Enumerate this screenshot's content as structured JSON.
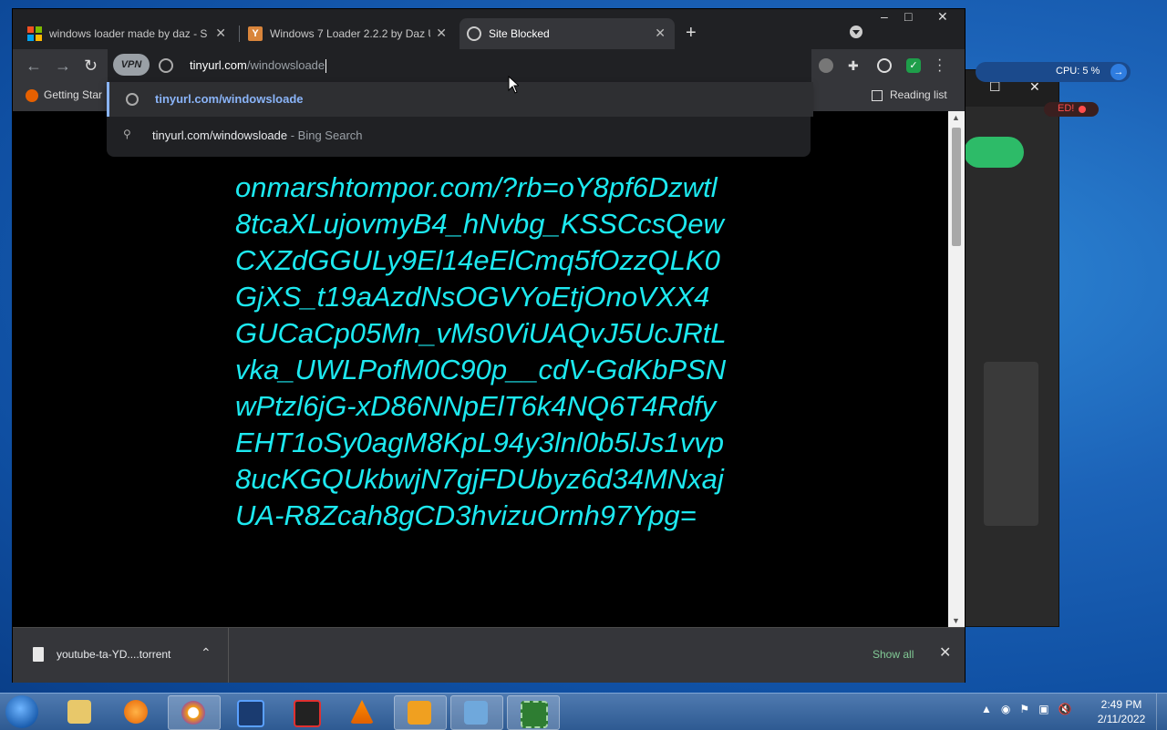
{
  "browser": {
    "tabs": [
      {
        "label": "windows loader made by daz - S",
        "icon": "microsoft-logo-icon",
        "active": false
      },
      {
        "label": "Windows 7 Loader 2.2.2 by Daz U",
        "icon": "y-favicon-icon",
        "active": false
      },
      {
        "label": "Site Blocked",
        "icon": "globe-icon",
        "active": true
      }
    ],
    "window_controls": {
      "minimize": "–",
      "maximize": "□",
      "close": "✕"
    },
    "omnibox": {
      "vpn_label": "VPN",
      "url_host": "tinyurl.com",
      "url_path": "/windowsloade"
    },
    "bookmarks": {
      "getting_started": "Getting Star",
      "reading_list": "Reading list"
    },
    "suggestions": [
      {
        "text": "tinyurl.com/windowsloade",
        "suffix": "",
        "icon": "globe-icon"
      },
      {
        "text": "tinyurl.com/windowsloade",
        "suffix": " - Bing Search",
        "icon": "search-icon"
      }
    ],
    "content": {
      "blocked_url": "onmarshtompor.com/?rb=oY8pf6Dzwtl8tcaXLujovmyB4_hNvbg_KSSCcsQewCXZdGGULy9El14eElCmq5fOzzQLK0GjXS_t19aAzdNsOGVYoEtjOnoVXX4GUCaCp05Mn_vMs0ViUAQvJ5UcJRtLvka_UWLPofM0C90p__cdV-GdKbPSNwPtzl6jG-xD86NNpElT6k4NQ6T4RdfyEHT1oSy0agM8KpL94y3lnl0b5lJs1vvp8ucKGQUkbwjN7gjFDUbyz6d34MNxajUA-R8Zcah8gCD3hvizuOrnh97Ypg="
    },
    "download": {
      "file_name": "youtube-ta-YD....torrent",
      "show_all": "Show all"
    }
  },
  "background_app": {
    "cpu_text": "CPU: 5 %",
    "status_text": "ED!"
  },
  "taskbar": {
    "time": "2:49 PM",
    "date": "2/11/2022",
    "apps": [
      "explorer",
      "firefox",
      "brave",
      "shield-app",
      "recorder",
      "vlc",
      "daz-app",
      "network-app",
      "grid-app"
    ]
  },
  "colors": {
    "blocked_text": "#1de9f0",
    "accent": "#8ab4f8"
  }
}
